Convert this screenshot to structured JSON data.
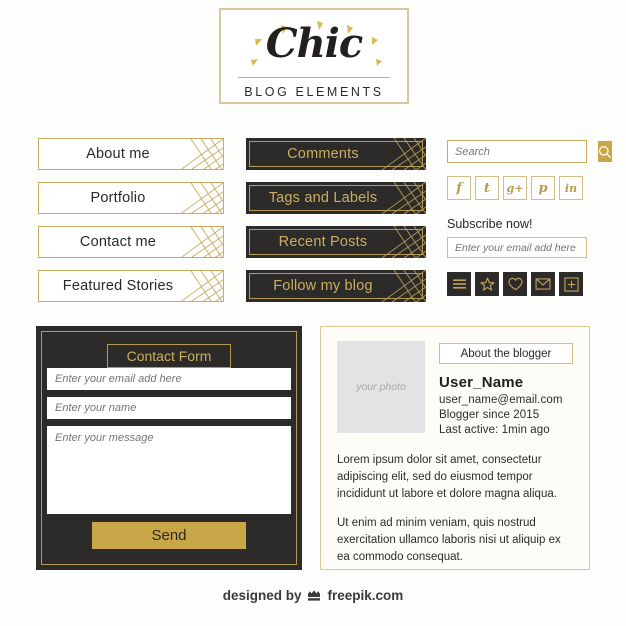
{
  "header": {
    "brand": "Chic",
    "subtitle": "BLOG ELEMENTS"
  },
  "nav_light": [
    {
      "label": "About me",
      "icon": "hatch-icon"
    },
    {
      "label": "Portfolio",
      "icon": "hatch-icon"
    },
    {
      "label": "Contact me",
      "icon": "hatch-icon"
    },
    {
      "label": "Featured Stories",
      "icon": "hatch-icon"
    }
  ],
  "nav_dark": [
    {
      "label": "Comments",
      "icon": "hatch-icon"
    },
    {
      "label": "Tags and Labels",
      "icon": "hatch-icon"
    },
    {
      "label": "Recent Posts",
      "icon": "hatch-icon"
    },
    {
      "label": "Follow my blog",
      "icon": "hatch-icon"
    }
  ],
  "search": {
    "placeholder": "Search",
    "value": "",
    "button_icon": "search-icon"
  },
  "social": [
    {
      "glyph": "f",
      "name": "facebook-icon"
    },
    {
      "glyph": "t",
      "name": "twitter-icon"
    },
    {
      "glyph": "g+",
      "name": "googleplus-icon"
    },
    {
      "glyph": "p",
      "name": "pinterest-icon"
    },
    {
      "glyph": "in",
      "name": "linkedin-icon"
    }
  ],
  "subscribe": {
    "label": "Subscribe now!",
    "placeholder": "Enter your email add here",
    "value": ""
  },
  "action_icons": [
    {
      "name": "menu-icon"
    },
    {
      "name": "star-icon"
    },
    {
      "name": "heart-icon"
    },
    {
      "name": "envelope-icon"
    },
    {
      "name": "plus-square-icon"
    }
  ],
  "contact_form": {
    "title": "Contact Form",
    "email_placeholder": "Enter your email add here",
    "email_value": "",
    "name_placeholder": "Enter your name",
    "name_value": "",
    "message_placeholder": "Enter your message",
    "message_value": "",
    "send_label": "Send"
  },
  "blogger": {
    "photo_label": "your photo",
    "about_label": "About the blogger",
    "user_name": "User_Name",
    "email": "user_name@email.com",
    "since": "Blogger since 2015",
    "last_active": "Last active: 1min ago",
    "paragraph_1": "Lorem ipsum dolor sit amet, consectetur adipiscing elit, sed do eiusmod tempor incididunt ut labore et dolore magna aliqua.",
    "paragraph_2": "Ut enim ad minim veniam, quis nostrud exercitation ullamco laboris nisi ut aliquip ex ea commodo consequat."
  },
  "footer": {
    "prefix": "designed by",
    "brand": "freepik.com",
    "icon": "freepik-logo-icon"
  },
  "colors": {
    "gold": "#c9a648",
    "gold_light": "#d3bd86",
    "gold_border": "#c9aa5e",
    "dark": "#2c2b29",
    "gold_text": "#cbae61",
    "cream": "#fdfcf7"
  }
}
